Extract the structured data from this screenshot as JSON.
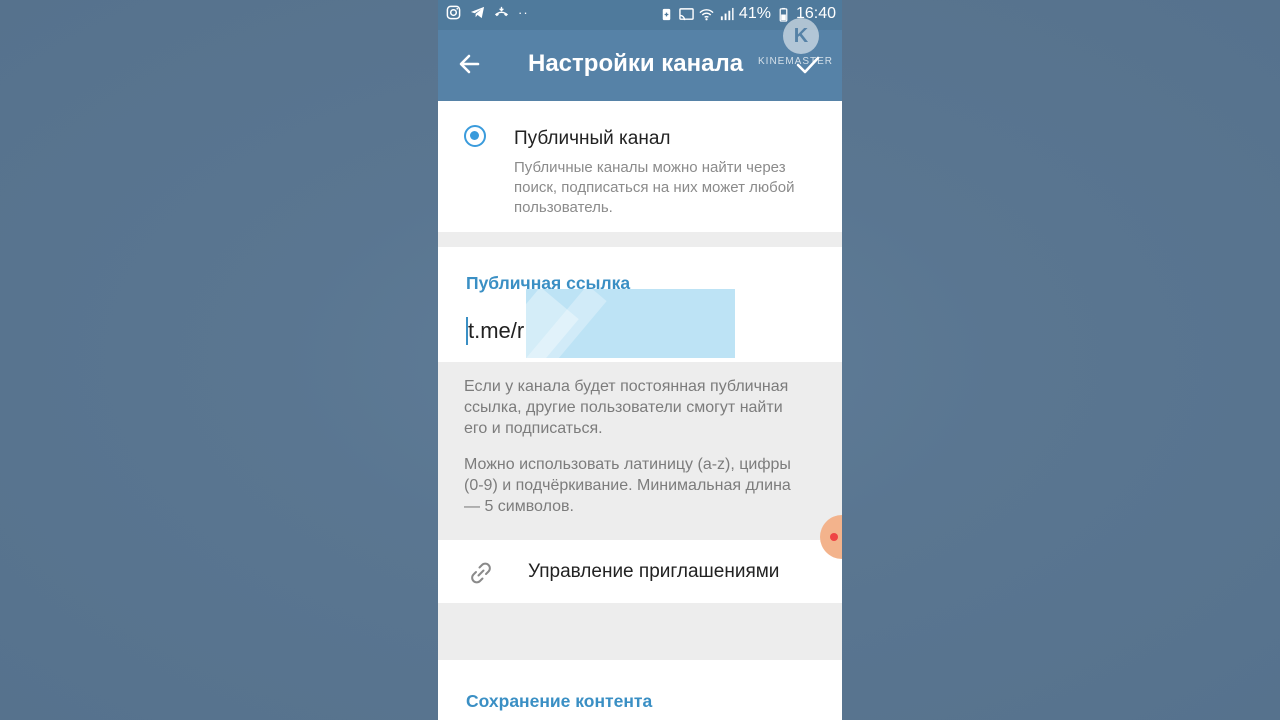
{
  "statusbar": {
    "left_icons": [
      "instagram-icon",
      "telegram-icon",
      "call-icon"
    ],
    "dots": "··",
    "battery_percent": "41%",
    "time": "16:40"
  },
  "appbar": {
    "title": "Настройки канала",
    "watermark_logo": "K",
    "watermark_text": "KINEMASTER"
  },
  "channel_type": {
    "option_title": "Публичный канал",
    "option_description": "Публичные каналы можно найти через поиск, подписаться на них может любой пользователь."
  },
  "public_link": {
    "section_title": "Публичная ссылка",
    "prefix": "t.me/r"
  },
  "info": {
    "paragraph1": "Если у канала будет постоянная публичная ссылка, другие пользователи смогут найти его и подписаться.",
    "paragraph2": "Можно использовать латиницу (a-z), цифры (0-9) и подчёркивание. Минимальная длина — 5 символов."
  },
  "invites": {
    "label": "Управление приглашениями"
  },
  "content_saving": {
    "section_title": "Сохранение контента"
  },
  "colors": {
    "appbar": "#5682a7",
    "accent": "#3a9bdc",
    "link_title": "#3a8fc4"
  }
}
